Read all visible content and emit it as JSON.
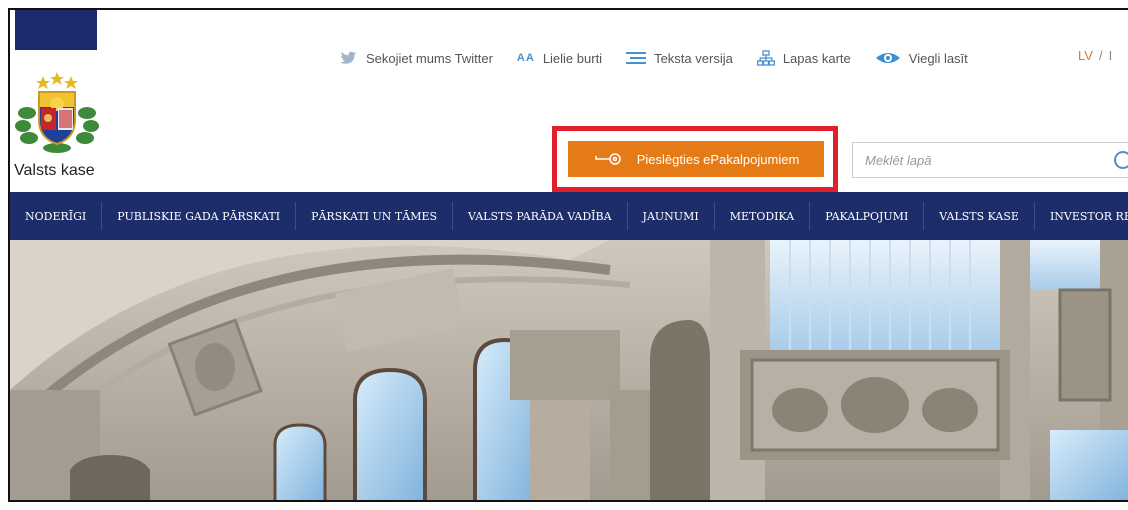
{
  "brand": {
    "logo_text": "Valsts kase",
    "accent": "#1c2d6a",
    "orange": "#e57b16"
  },
  "toplinks": [
    {
      "label": "Sekojiet mums Twitter",
      "icon": "twitter-icon"
    },
    {
      "label": "Lielie burti",
      "icon": "font-size-icon",
      "icon_text": "AA"
    },
    {
      "label": "Teksta versija",
      "icon": "text-lines-icon"
    },
    {
      "label": "Lapas karte",
      "icon": "sitemap-icon"
    },
    {
      "label": "Viegli lasīt",
      "icon": "eye-icon"
    }
  ],
  "language": {
    "current": "LV",
    "separator": "/",
    "other": "I"
  },
  "epakalpojumi": {
    "label": "Pieslēgties ePakalpojumiem",
    "icon": "key-icon"
  },
  "search": {
    "placeholder": "Meklēt lapā",
    "icon": "search-icon"
  },
  "nav": [
    "NODERĪGI",
    "PUBLISKIE GADA PĀRSKATI",
    "PĀRSKATI UN TĀMES",
    "VALSTS PARĀDA VADĪBA",
    "JAUNUMI",
    "METODIKA",
    "PAKALPOJUMI",
    "VALSTS KASE",
    "INVESTOR RELATIONS"
  ]
}
